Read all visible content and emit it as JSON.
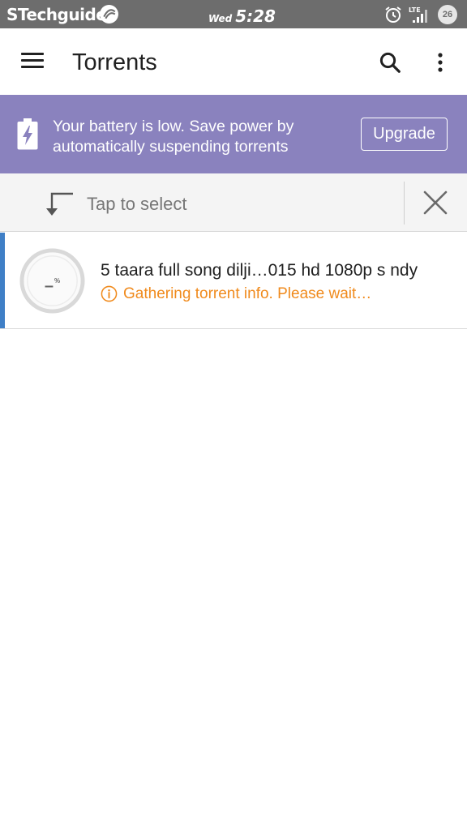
{
  "status_bar": {
    "brand": "STechguide",
    "day": "Wed",
    "time": "5:28",
    "network": "LTE",
    "battery_level": "26"
  },
  "app_bar": {
    "title": "Torrents",
    "icons": [
      "menu-icon",
      "search-icon",
      "more-vert-icon"
    ]
  },
  "banner": {
    "message": "Your battery is low. Save power by automatically suspending torrents",
    "upgrade_label": "Upgrade",
    "background_color": "#8a82be",
    "icon": "battery-charging-icon"
  },
  "selection_bar": {
    "prompt": "Tap to select",
    "icons": [
      "select-arrow-icon",
      "close-icon"
    ]
  },
  "torrents": [
    {
      "name": "5 taara full song dilji…015 hd 1080p s ndy",
      "status": "Gathering torrent info. Please wait…",
      "progress_label": "–",
      "progress_unit": "%",
      "status_color": "#f08a1c",
      "accent_color": "#3f7fc6"
    }
  ]
}
